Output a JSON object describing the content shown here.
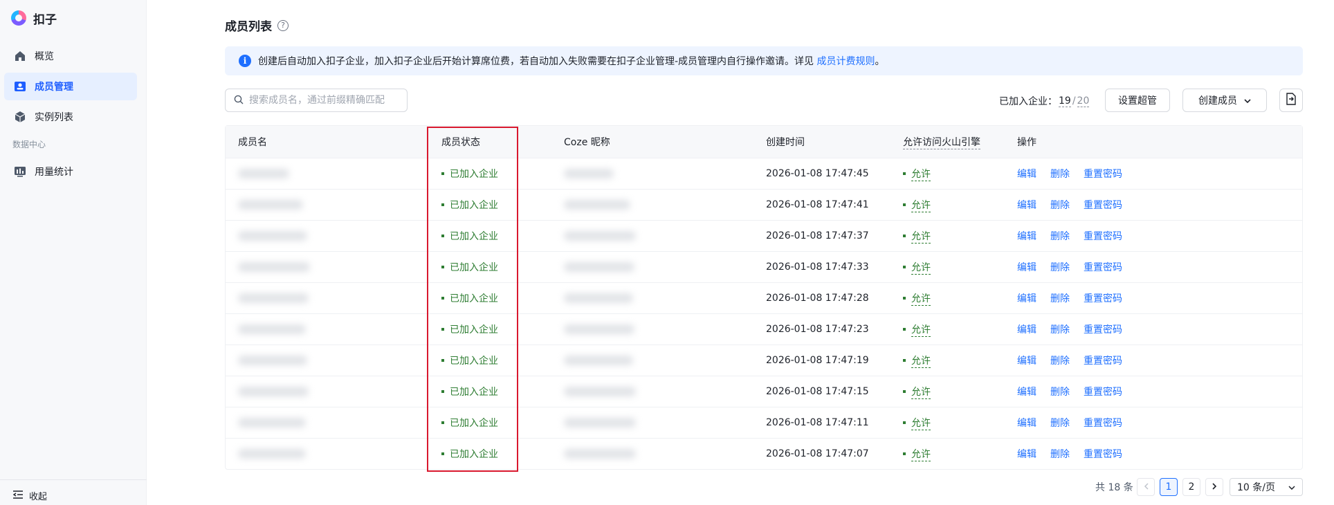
{
  "app": {
    "name": "扣子",
    "logo_icon": "coze-logo-icon"
  },
  "sidebar": {
    "items": [
      {
        "label": "概览",
        "icon": "home-icon"
      },
      {
        "label": "成员管理",
        "icon": "member-card-icon",
        "active": true
      },
      {
        "label": "实例列表",
        "icon": "cube-icon"
      }
    ],
    "group_label": "数据中心",
    "group_items": [
      {
        "label": "用量统计",
        "icon": "stats-monitor-icon"
      }
    ],
    "collapse_label": "收起"
  },
  "page": {
    "title": "成员列表",
    "help_glyph": "?",
    "notice": {
      "text": "创建后自动加入扣子企业，加入扣子企业后开始计算席位费，若自动加入失败需要在扣子企业管理-成员管理内自行操作邀请。详见 ",
      "link": "成员计费规则",
      "suffix": "。"
    },
    "search": {
      "placeholder": "搜索成员名，通过前缀精确匹配"
    },
    "joined": {
      "label": "已加入企业：",
      "count": "19",
      "sep": "/",
      "total": "20"
    },
    "buttons": {
      "super_admin": "设置超管",
      "create_member": "创建成员"
    }
  },
  "table": {
    "columns": [
      "成员名",
      "成员状态",
      "Coze 昵称",
      "创建时间",
      "允许访问火山引擎",
      "操作"
    ],
    "rows": [
      {
        "status": "已加入企业",
        "created": "2026-01-08 17:47:45",
        "allow": "允许"
      },
      {
        "status": "已加入企业",
        "created": "2026-01-08 17:47:41",
        "allow": "允许"
      },
      {
        "status": "已加入企业",
        "created": "2026-01-08 17:47:37",
        "allow": "允许"
      },
      {
        "status": "已加入企业",
        "created": "2026-01-08 17:47:33",
        "allow": "允许"
      },
      {
        "status": "已加入企业",
        "created": "2026-01-08 17:47:28",
        "allow": "允许"
      },
      {
        "status": "已加入企业",
        "created": "2026-01-08 17:47:23",
        "allow": "允许"
      },
      {
        "status": "已加入企业",
        "created": "2026-01-08 17:47:19",
        "allow": "允许"
      },
      {
        "status": "已加入企业",
        "created": "2026-01-08 17:47:15",
        "allow": "允许"
      },
      {
        "status": "已加入企业",
        "created": "2026-01-08 17:47:11",
        "allow": "允许"
      },
      {
        "status": "已加入企业",
        "created": "2026-01-08 17:47:07",
        "allow": "允许"
      }
    ],
    "actions": {
      "edit": "编辑",
      "delete": "删除",
      "reset": "重置密码"
    }
  },
  "pagination": {
    "total": "共 18 条",
    "pages": [
      "1",
      "2"
    ],
    "current": "1",
    "page_size": "10 条/页"
  },
  "colors": {
    "accent": "#1e6fff",
    "status_green": "#2e7d32",
    "highlight_red": "#d9182e"
  }
}
